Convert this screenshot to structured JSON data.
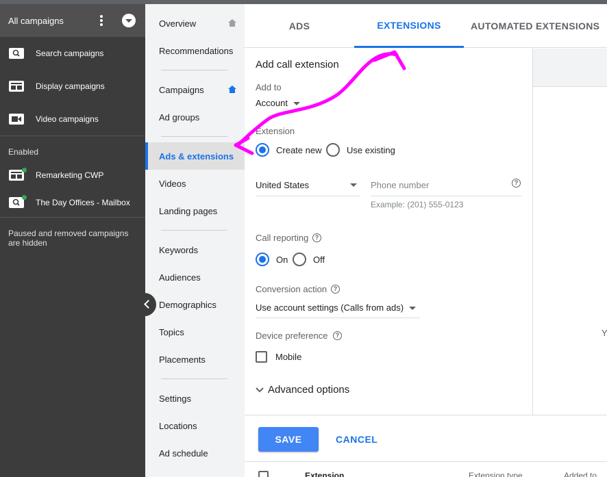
{
  "sidebar": {
    "header_title": "All campaigns",
    "items": [
      {
        "label": "Search campaigns",
        "icon": "search-icon"
      },
      {
        "label": "Display campaigns",
        "icon": "display-icon"
      },
      {
        "label": "Video campaigns",
        "icon": "video-icon"
      }
    ],
    "section_label": "Enabled",
    "campaigns": [
      {
        "label": "Remarketing CWP",
        "icon": "display-icon",
        "status_color": "#34a853"
      },
      {
        "label": "The Day Offices - Mailbox",
        "icon": "search-icon",
        "status_color": "#34a853"
      }
    ],
    "note": "Paused and removed campaigns are hidden"
  },
  "nav": {
    "items": [
      "Overview",
      "Recommendations",
      "Campaigns",
      "Ad groups",
      "Ads & extensions",
      "Videos",
      "Landing pages",
      "Keywords",
      "Audiences",
      "Demographics",
      "Topics",
      "Placements",
      "Settings",
      "Locations",
      "Ad schedule"
    ],
    "active": "Ads & extensions"
  },
  "tabs": {
    "ads": "ADS",
    "extensions": "EXTENSIONS",
    "automated": "AUTOMATED EXTENSIONS"
  },
  "form": {
    "title": "Add call extension",
    "add_to_label": "Add to",
    "add_to_value": "Account",
    "extension_label": "Extension",
    "create_new": "Create new",
    "use_existing": "Use existing",
    "country": "United States",
    "phone_placeholder": "Phone number",
    "phone_example": "Example: (201) 555-0123",
    "call_reporting_label": "Call reporting",
    "on_label": "On",
    "off_label": "Off",
    "conversion_label": "Conversion action",
    "conversion_value": "Use account settings (Calls from ads)",
    "device_label": "Device preference",
    "mobile_label": "Mobile",
    "advanced": "Advanced options",
    "help_glyph": "?"
  },
  "buttons": {
    "save": "SAVE",
    "cancel": "CANCEL"
  },
  "table": {
    "col_extension": "Extension",
    "col_type": "Extension type",
    "col_added": "Added to"
  },
  "edge_text": "Y",
  "colors": {
    "accent": "#1a73e8",
    "sidebar_bg": "#3c3c3c",
    "annotation": "#ff00ff"
  }
}
